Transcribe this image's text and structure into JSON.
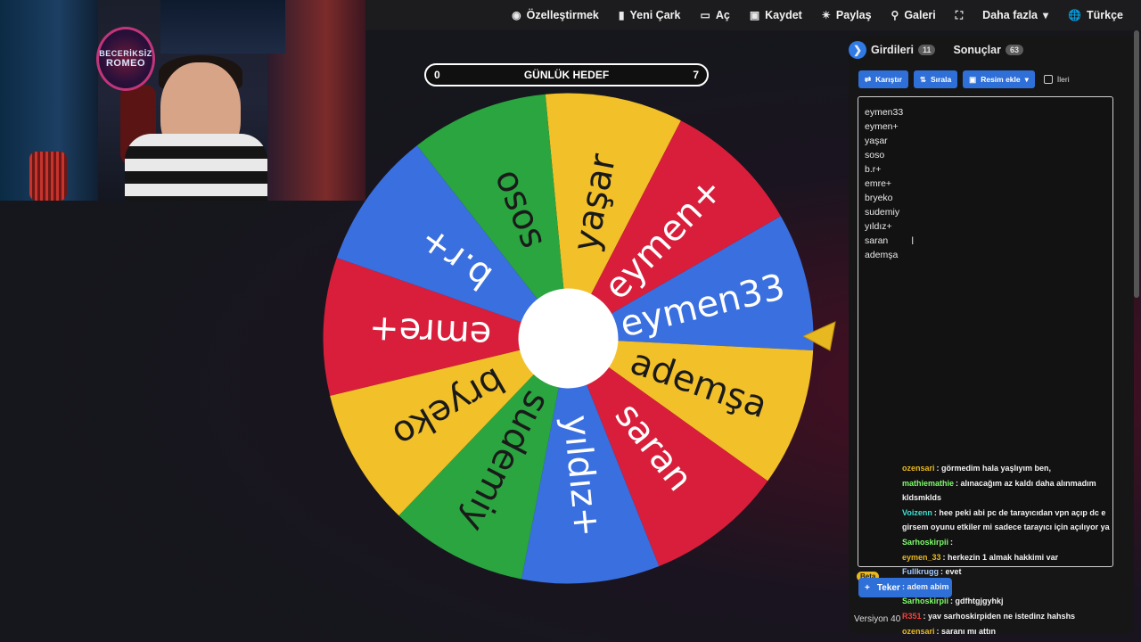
{
  "nav": {
    "items": [
      {
        "label": "Özelleştirmek",
        "icon": "palette-icon"
      },
      {
        "label": "Yeni Çark",
        "icon": "file-icon"
      },
      {
        "label": "Aç",
        "icon": "folder-open-icon"
      },
      {
        "label": "Kaydet",
        "icon": "save-icon"
      },
      {
        "label": "Paylaş",
        "icon": "share-icon"
      },
      {
        "label": "Galeri",
        "icon": "search-icon"
      },
      {
        "label": "",
        "icon": "fullscreen-icon"
      },
      {
        "label": "Daha fazla",
        "icon": "chevron-down-icon"
      },
      {
        "label": "Türkçe",
        "icon": "globe-icon"
      }
    ]
  },
  "webcam": {
    "logo_line1": "BECERİKSİZ",
    "logo_line2": "ROMEO"
  },
  "goal": {
    "left": "0",
    "title": "GÜNLÜK HEDEF",
    "right": "7"
  },
  "wheel": {
    "segments": [
      {
        "label": "yaşar",
        "color": "#F2C029"
      },
      {
        "label": "eymen+",
        "color": "#D81E3A"
      },
      {
        "label": "eymen33",
        "color": "#3A6FE0"
      },
      {
        "label": "ademşa",
        "color": "#F2C029"
      },
      {
        "label": "saran",
        "color": "#D81E3A"
      },
      {
        "label": "yıldız+",
        "color": "#3A6FE0"
      },
      {
        "label": "sudemiy",
        "color": "#2AA53F"
      },
      {
        "label": "bryeko",
        "color": "#F2C029"
      },
      {
        "label": "emre+",
        "color": "#D81E3A"
      },
      {
        "label": "b.r+",
        "color": "#3A6FE0"
      },
      {
        "label": "soso",
        "color": "#2AA53F"
      }
    ],
    "pointer_color": "#E8B820"
  },
  "panel": {
    "tab_entries": "Girdileri",
    "tab_entries_count": "11",
    "tab_results": "Sonuçlar",
    "tab_results_count": "63",
    "btn_shuffle": "Karıştır",
    "btn_sort": "Sırala",
    "btn_add_image": "Resim ekle",
    "advanced_label": "İleri",
    "entries": [
      "eymen33",
      "eymen+",
      "yaşar",
      "soso",
      "b.r+",
      "emre+",
      "bryeko",
      "sudemiy",
      "yıldız+",
      "saran",
      "ademşa"
    ],
    "beta": "Beta",
    "bottom_button": "Teker",
    "version": "Versiyon 40"
  },
  "chat": [
    {
      "user": "ozensari",
      "user_color": "#E8B820",
      "text": ": görmedim hala yaşlıyım ben,"
    },
    {
      "user": "mathiemathie",
      "user_color": "#7CFC6A",
      "text": ": alınacağım az kaldı daha alınmadım"
    },
    {
      "user": "",
      "user_color": "#ffffff",
      "text": "kldsmklds"
    },
    {
      "user": "Voizenn",
      "user_color": "#3CE0D0",
      "text": ": hee peki abi pc de tarayıcıdan vpn açıp dc e"
    },
    {
      "user": "",
      "user_color": "#ffffff",
      "text": "girsem oyunu etkiler mi sadece tarayıcı için açılıyor ya"
    },
    {
      "user": "Sarhoskirpii",
      "user_color": "#7CFC6A",
      "text": ":"
    },
    {
      "user": "eymen_33",
      "user_color": "#E8B820",
      "text": ": herkezin 1 almak hakkimi var"
    },
    {
      "user": "Fullkrugg",
      "user_color": "#A0C8FF",
      "text": ": evet"
    },
    {
      "user": "",
      "user_color": "#ff5a5a",
      "text": ": adem abim"
    },
    {
      "user": "Sarhoskirpii",
      "user_color": "#7CFC6A",
      "text": ": gdfhtgjgyhkj"
    },
    {
      "user": "R351",
      "user_color": "#ff3a3a",
      "text": ": yav sarhoskirpiden ne istedinz hahshs"
    },
    {
      "user": "ozensari",
      "user_color": "#E8B820",
      "text": ": saranı mı attın"
    }
  ]
}
